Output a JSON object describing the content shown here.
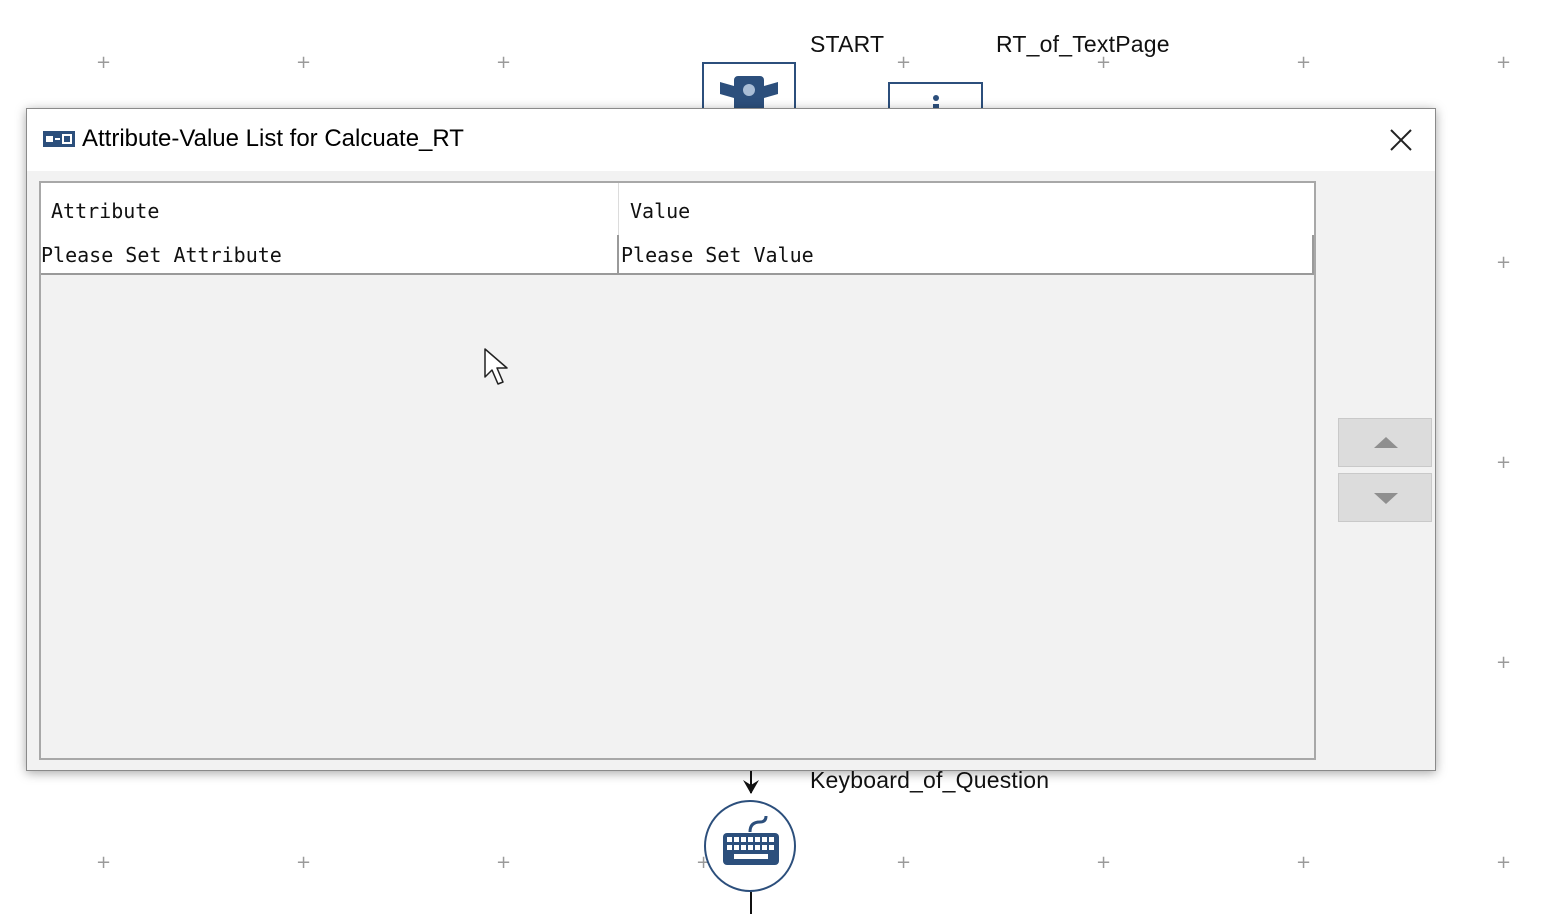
{
  "canvas": {
    "labels": {
      "start": "START",
      "rt_text_page": "RT_of_TextPage",
      "keyboard_question": "Keyboard_of_Question"
    }
  },
  "dialog": {
    "title": "Attribute-Value List for Calcuate_RT",
    "table": {
      "columns": [
        "Attribute",
        "Value"
      ],
      "rows": [
        {
          "attribute": "Please Set Attribute",
          "value": "Please Set Value"
        }
      ]
    },
    "buttons": {
      "move_up_icon": "triangle-up-icon",
      "move_down_icon": "triangle-down-icon",
      "close_icon": "close-icon"
    }
  },
  "colors": {
    "node_border": "#2c4f7c",
    "dialog_bg": "#f2f2f2",
    "grid_plus": "#9a9a9a"
  }
}
